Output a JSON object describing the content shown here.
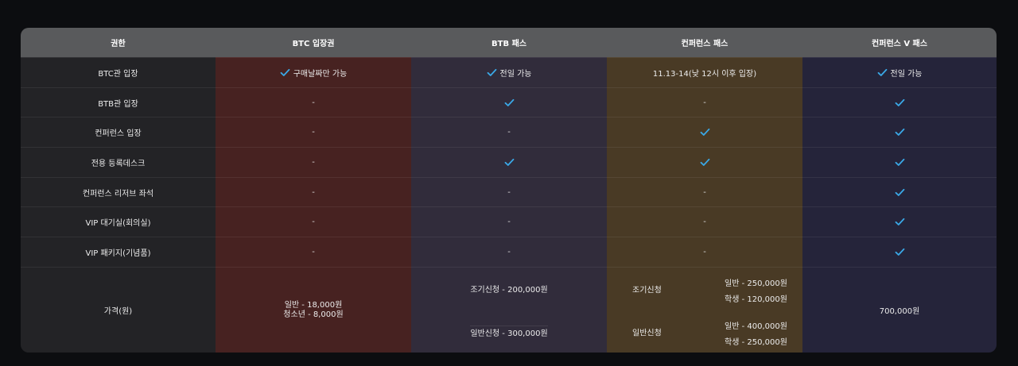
{
  "header": [
    "권한",
    "BTC 입장권",
    "BTB 패스",
    "컨퍼런스 패스",
    "컨퍼런스 V 패스"
  ],
  "rows": [
    {
      "label": "BTC관 입장",
      "cells": [
        {
          "check": true,
          "text": "구매날짜만 가능"
        },
        {
          "check": true,
          "text": "전일 가능"
        },
        {
          "check": false,
          "text": "11.13-14(낮 12시 이후 입장)"
        },
        {
          "check": true,
          "text": "전일 가능"
        }
      ]
    },
    {
      "label": "BTB관 입장",
      "cells": [
        {
          "check": false,
          "text": "-"
        },
        {
          "check": true,
          "text": ""
        },
        {
          "check": false,
          "text": "-"
        },
        {
          "check": true,
          "text": ""
        }
      ]
    },
    {
      "label": "컨퍼런스 입장",
      "cells": [
        {
          "check": false,
          "text": "-"
        },
        {
          "check": false,
          "text": "-"
        },
        {
          "check": true,
          "text": ""
        },
        {
          "check": true,
          "text": ""
        }
      ]
    },
    {
      "label": "전용 등록데스크",
      "cells": [
        {
          "check": false,
          "text": "-"
        },
        {
          "check": true,
          "text": ""
        },
        {
          "check": true,
          "text": ""
        },
        {
          "check": true,
          "text": ""
        }
      ]
    },
    {
      "label": "컨퍼런스 리저브 좌석",
      "cells": [
        {
          "check": false,
          "text": "-"
        },
        {
          "check": false,
          "text": "-"
        },
        {
          "check": false,
          "text": "-"
        },
        {
          "check": true,
          "text": ""
        }
      ]
    },
    {
      "label": "VIP 대기실(회의실)",
      "cells": [
        {
          "check": false,
          "text": "-"
        },
        {
          "check": false,
          "text": "-"
        },
        {
          "check": false,
          "text": "-"
        },
        {
          "check": true,
          "text": ""
        }
      ]
    },
    {
      "label": "VIP 패키지(기념품)",
      "cells": [
        {
          "check": false,
          "text": "-"
        },
        {
          "check": false,
          "text": "-"
        },
        {
          "check": false,
          "text": "-"
        },
        {
          "check": true,
          "text": ""
        }
      ]
    }
  ],
  "price": {
    "label": "가격(원)",
    "btc": {
      "line1": "일반 - 18,000원",
      "line2": "청소년 - 8,000원"
    },
    "btb": {
      "early": "조기신청 - 200,000원",
      "regular": "일반신청 - 300,000원"
    },
    "conf": {
      "early": {
        "label": "조기신청",
        "general": "일반 - 250,000원",
        "student": "학생 -  120,000원"
      },
      "regular": {
        "label": "일반신청",
        "general": "일반 - 400,000원",
        "student": "학생 - 250,000원"
      }
    },
    "confv": "700,000원"
  },
  "colors": {
    "check": "#3aa8e6",
    "header": "#595a5c"
  },
  "icons": {
    "check": "check-icon"
  }
}
